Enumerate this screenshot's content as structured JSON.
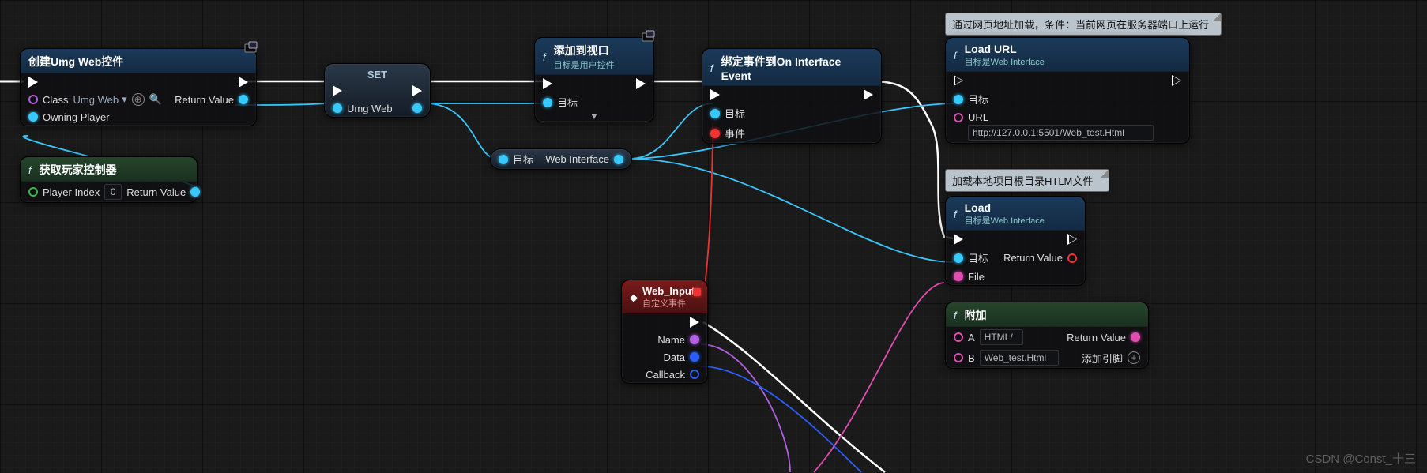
{
  "watermark": "CSDN @Const_十三",
  "comments": {
    "c1": "通过网页地址加载，条件：当前网页在服务器端口上运行",
    "c2": "加载本地项目根目录HTLM文件"
  },
  "nodes": {
    "create": {
      "title": "创建Umg Web控件",
      "class_label": "Class",
      "class_value": "Umg Web",
      "owning": "Owning Player",
      "return": "Return Value"
    },
    "getpc": {
      "title": "获取玩家控制器",
      "pidx_label": "Player Index",
      "pidx_value": "0",
      "return": "Return Value"
    },
    "set": {
      "title": "SET",
      "pin": "Umg Web"
    },
    "addvp": {
      "title": "添加到视口",
      "sub": "目标是用户控件",
      "target": "目标"
    },
    "reroute": {
      "target": "目标",
      "iface": "Web Interface"
    },
    "bind": {
      "title": "绑定事件到On Interface Event",
      "target": "目标",
      "event": "事件"
    },
    "webinput": {
      "title": "Web_Input",
      "sub": "自定义事件",
      "name": "Name",
      "data": "Data",
      "callback": "Callback"
    },
    "loadurl": {
      "title": "Load URL",
      "sub": "目标是Web Interface",
      "target": "目标",
      "url_label": "URL",
      "url_value": "http://127.0.0.1:5501/Web_test.Html"
    },
    "load": {
      "title": "Load",
      "sub": "目标是Web Interface",
      "target": "目标",
      "file": "File",
      "return": "Return Value"
    },
    "append": {
      "title": "附加",
      "a": "A",
      "b": "B",
      "a_val": "HTML/",
      "b_val": "Web_test.Html",
      "return": "Return Value",
      "add": "添加引脚"
    }
  }
}
